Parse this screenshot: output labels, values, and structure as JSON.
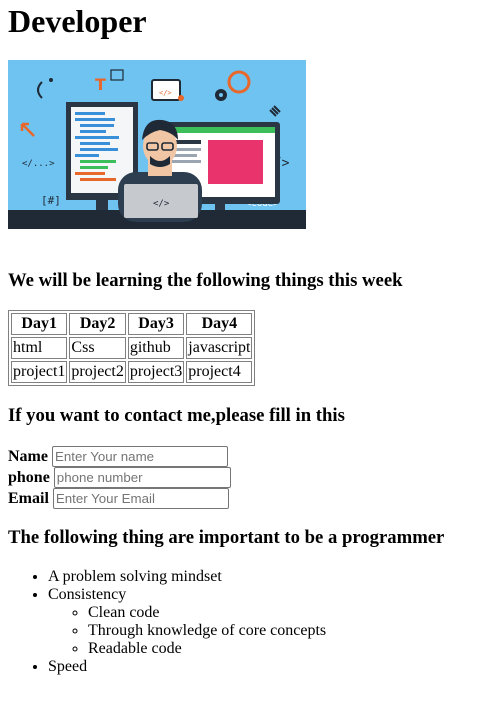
{
  "page": {
    "title": "Developer"
  },
  "hero": {
    "image_labels": [
      "</>",
      "</>",
      "</>",
      "[#]",
      "<code>",
      "T",
      "</...>"
    ],
    "colors": {
      "sky": "#6fc3f0",
      "desk": "#1f2a36",
      "shirt": "#2c3e50",
      "screen_green": "#3cbf5a",
      "screen_pink": "#e8336d"
    }
  },
  "learn": {
    "heading": "We will be learning the following things this week",
    "headers": [
      "Day1",
      "Day2",
      "Day3",
      "Day4"
    ],
    "rows": [
      [
        "html",
        "Css",
        "github",
        "javascript"
      ],
      [
        "project1",
        "project2",
        "project3",
        "project4"
      ]
    ]
  },
  "contact": {
    "heading": "If you want to contact me,please fill in this",
    "name_label": "Name",
    "name_placeholder": "Enter Your name",
    "phone_label": "phone",
    "phone_placeholder": "phone number",
    "email_label": "Email",
    "email_placeholder": "Enter Your Email"
  },
  "important": {
    "heading": "The following thing are important to be a programmer",
    "item1": "A problem solving mindset",
    "item2": "Consistency",
    "sub1": "Clean code",
    "sub2": "Through knowledge of core concepts",
    "sub3": "Readable code",
    "item3": "Speed"
  }
}
